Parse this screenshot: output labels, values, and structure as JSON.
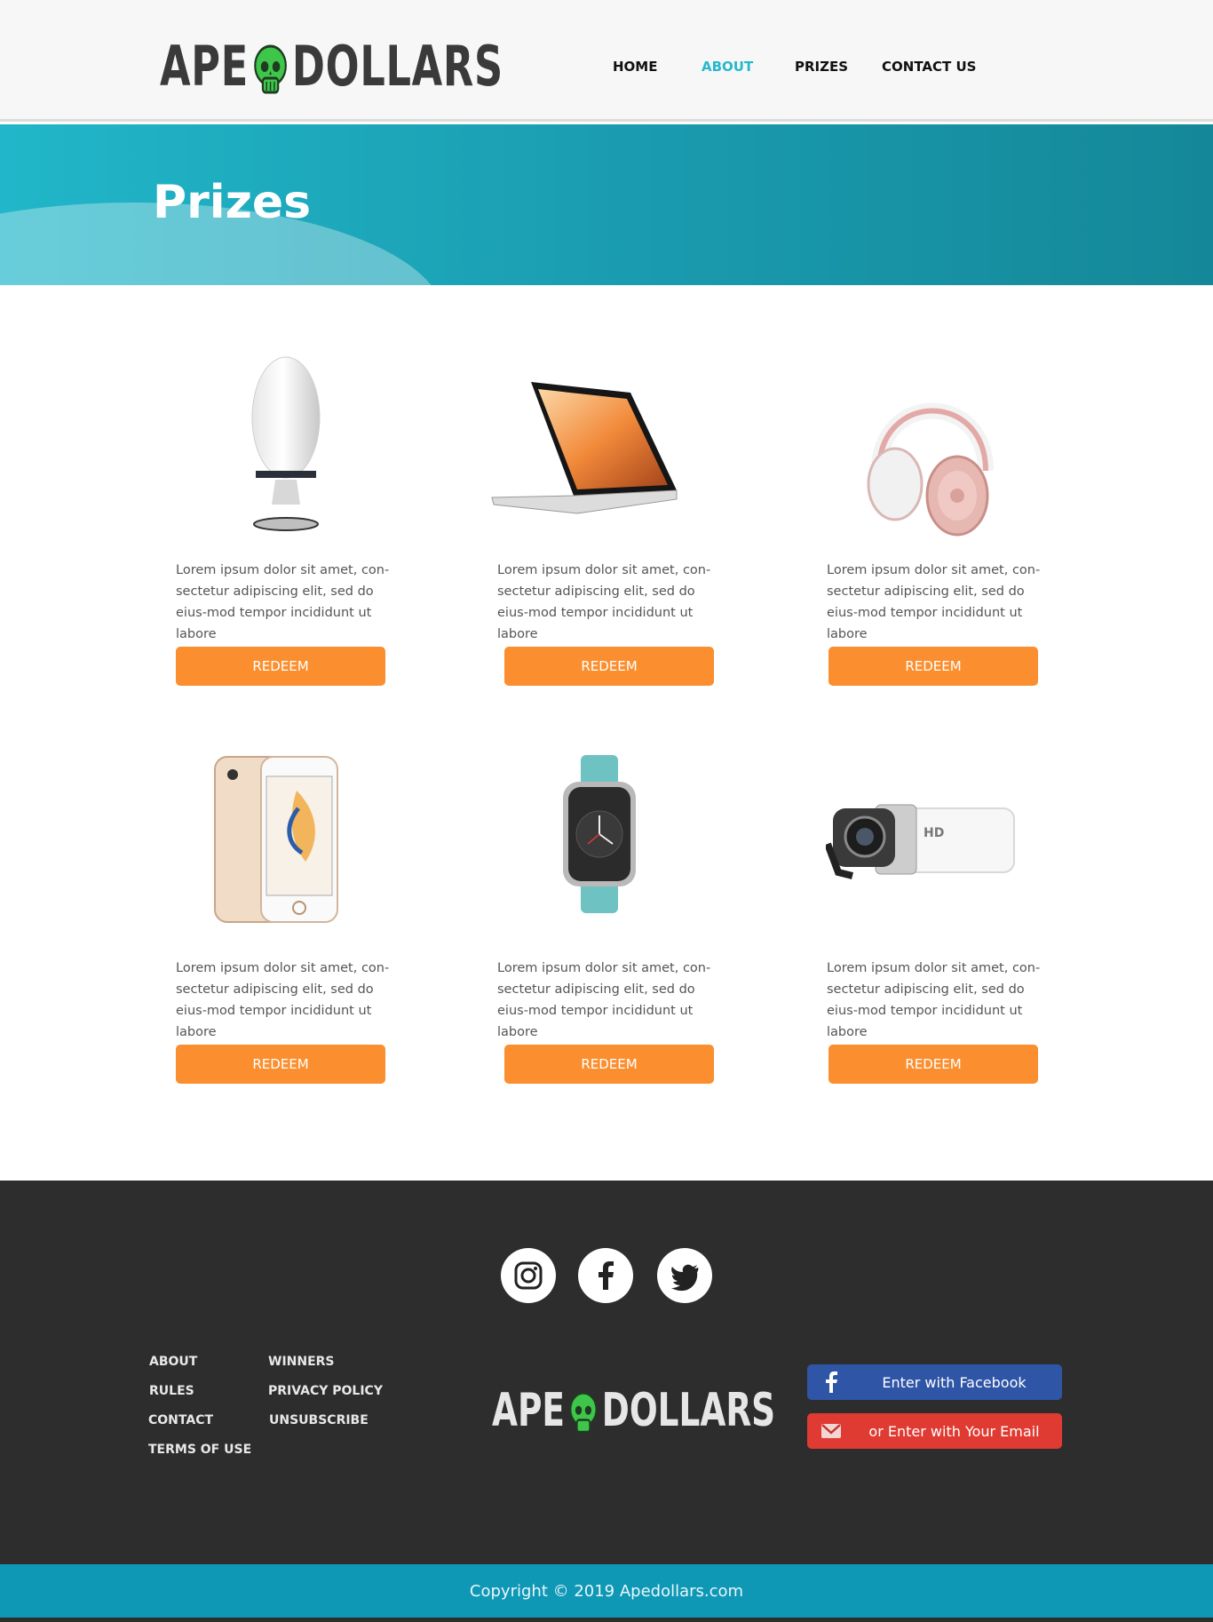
{
  "brand": {
    "name_left": "APE",
    "name_right": "DOLLARS"
  },
  "nav": {
    "home": "HOME",
    "about": "ABOUT",
    "prizes": "PRIZES",
    "contact": "CONTACT US",
    "active_color": "#27b8cc"
  },
  "hero": {
    "title": "Prizes"
  },
  "prizes": [
    {
      "icon": "speaker-image",
      "text": "Lorem ipsum dolor sit amet, con-sectetur adipiscing elit, sed do eius-mod tempor incididunt ut labore",
      "button": "REDEEM"
    },
    {
      "icon": "laptop-image",
      "text": "Lorem ipsum dolor sit amet, con-sectetur adipiscing elit, sed do eius-mod tempor incididunt ut labore",
      "button": "REDEEM"
    },
    {
      "icon": "headphones-image",
      "text": "Lorem ipsum dolor sit amet, con-sectetur adipiscing elit, sed do eius-mod tempor incididunt ut labore",
      "button": "REDEEM"
    },
    {
      "icon": "smartphone-image",
      "text": "Lorem ipsum dolor sit amet, con-sectetur adipiscing elit, sed do eius-mod tempor incididunt ut labore",
      "button": "REDEEM"
    },
    {
      "icon": "smartwatch-image",
      "text": "Lorem ipsum dolor sit amet, con-sectetur adipiscing elit, sed do eius-mod tempor incididunt ut labore",
      "button": "REDEEM"
    },
    {
      "icon": "camcorder-image",
      "text": "Lorem ipsum dolor sit amet, con-sectetur adipiscing elit, sed do eius-mod tempor incididunt ut labore",
      "button": "REDEEM"
    }
  ],
  "colors": {
    "accent": "#fb8f2f",
    "hero": "#1a9aae",
    "footer": "#2d2d2d",
    "copyright_bar": "#0e98b5"
  },
  "footer": {
    "social": [
      "instagram-icon",
      "facebook-icon",
      "twitter-icon"
    ],
    "links_col1": [
      "ABOUT",
      "RULES",
      "CONTACT",
      "TERMS OF USE"
    ],
    "links_col2": [
      "WINNERS",
      "PRIVACY POLICY",
      "UNSUBSCRIBE"
    ],
    "enter_facebook": "Enter with Facebook",
    "enter_email": "or Enter with Your Email",
    "copyright": "Copyright © 2019 Apedollars.com"
  }
}
